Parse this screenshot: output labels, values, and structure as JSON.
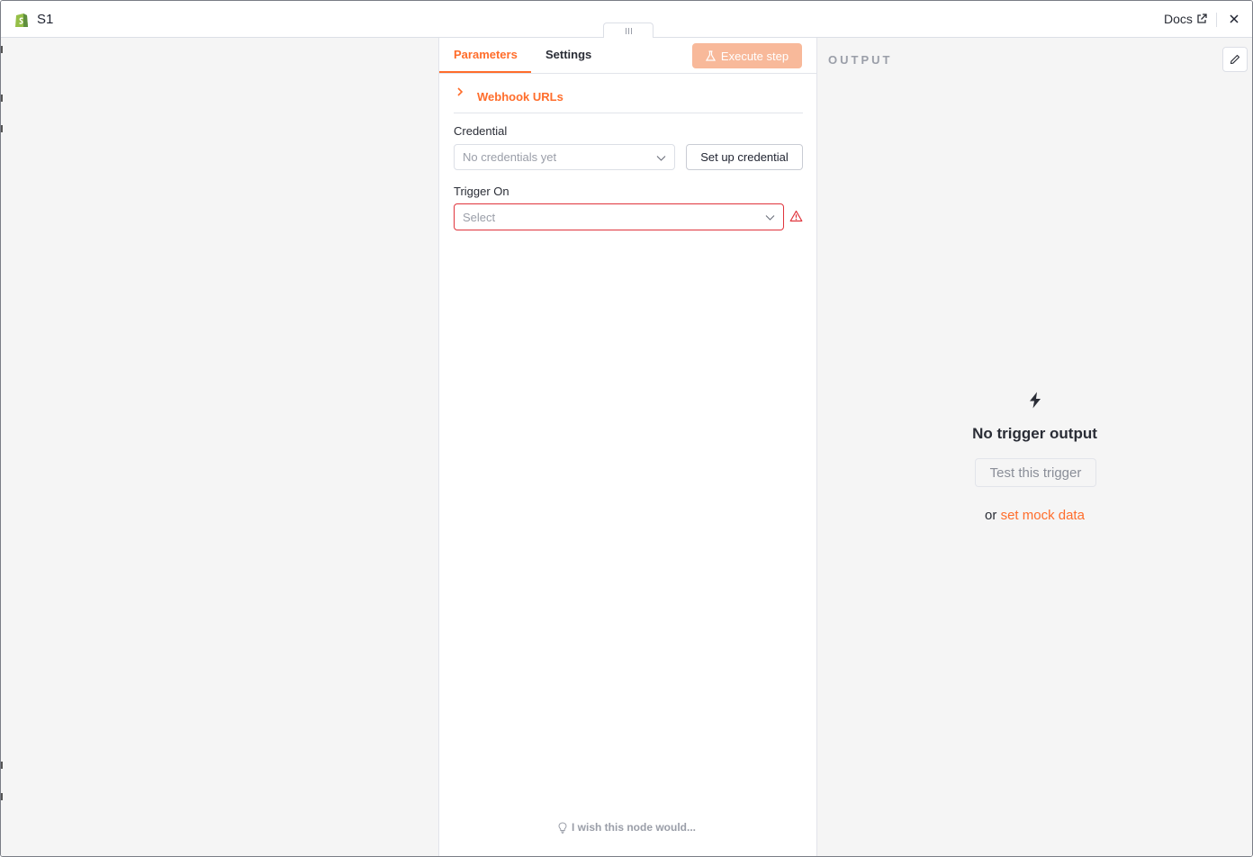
{
  "header": {
    "node_title": "S1",
    "docs_label": "Docs"
  },
  "tabs": {
    "parameters": "Parameters",
    "settings": "Settings"
  },
  "execute_button": "Execute step",
  "webhook_urls_label": "Webhook URLs",
  "credential": {
    "label": "Credential",
    "placeholder": "No credentials yet",
    "setup_button": "Set up credential"
  },
  "trigger_on": {
    "label": "Trigger On",
    "placeholder": "Select"
  },
  "wish_link": "I wish this node would...",
  "output": {
    "title": "OUTPUT",
    "empty_title": "No trigger output",
    "test_button": "Test this trigger",
    "or_text": "or",
    "mock_link": "set mock data"
  },
  "colors": {
    "accent": "#ff6d2b",
    "error": "#e0343c",
    "shopify_green": "#95bf47"
  },
  "icons": [
    "shopify-icon",
    "external-link-icon",
    "close-icon",
    "flask-icon",
    "chevron-right-icon",
    "chevron-down-icon",
    "warning-icon",
    "lightbulb-icon",
    "pencil-icon",
    "bolt-icon"
  ]
}
